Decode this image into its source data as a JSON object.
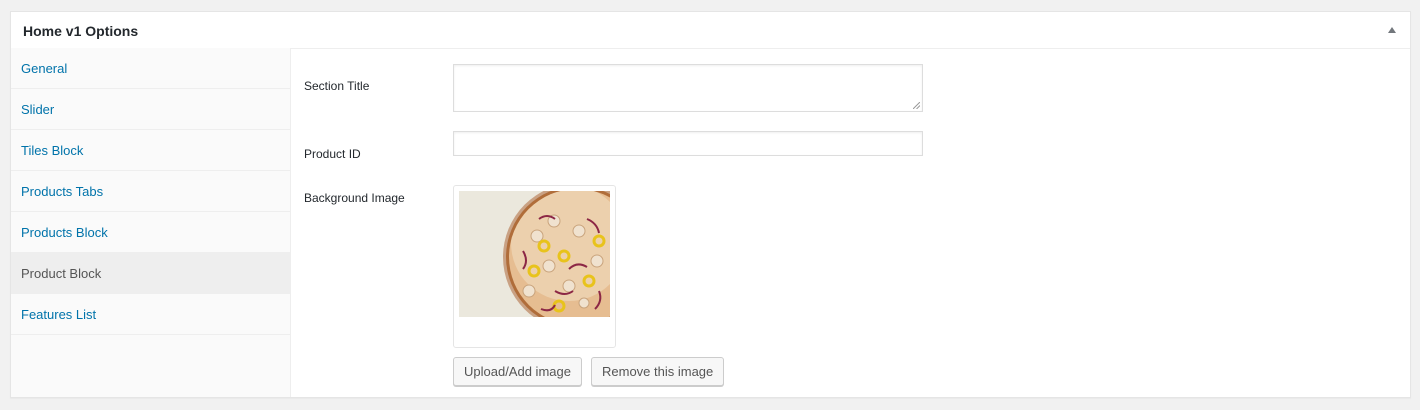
{
  "box": {
    "title": "Home v1 Options",
    "toggle_icon": "triangle-up-icon"
  },
  "tabs": [
    {
      "label": "General",
      "active": false
    },
    {
      "label": "Slider",
      "active": false
    },
    {
      "label": "Tiles Block",
      "active": false
    },
    {
      "label": "Products Tabs",
      "active": false
    },
    {
      "label": "Products Block",
      "active": false
    },
    {
      "label": "Product Block",
      "active": true
    },
    {
      "label": "Features List",
      "active": false
    }
  ],
  "fields": {
    "section_title": {
      "label": "Section Title",
      "value": ""
    },
    "product_id": {
      "label": "Product ID",
      "value": ""
    },
    "background_image": {
      "label": "Background Image",
      "image": "pizza-image"
    }
  },
  "buttons": {
    "upload": "Upload/Add image",
    "remove": "Remove this image"
  },
  "colors": {
    "link": "#0073aa",
    "active_tab_bg": "#eeeeee",
    "active_tab_text": "#555555"
  }
}
